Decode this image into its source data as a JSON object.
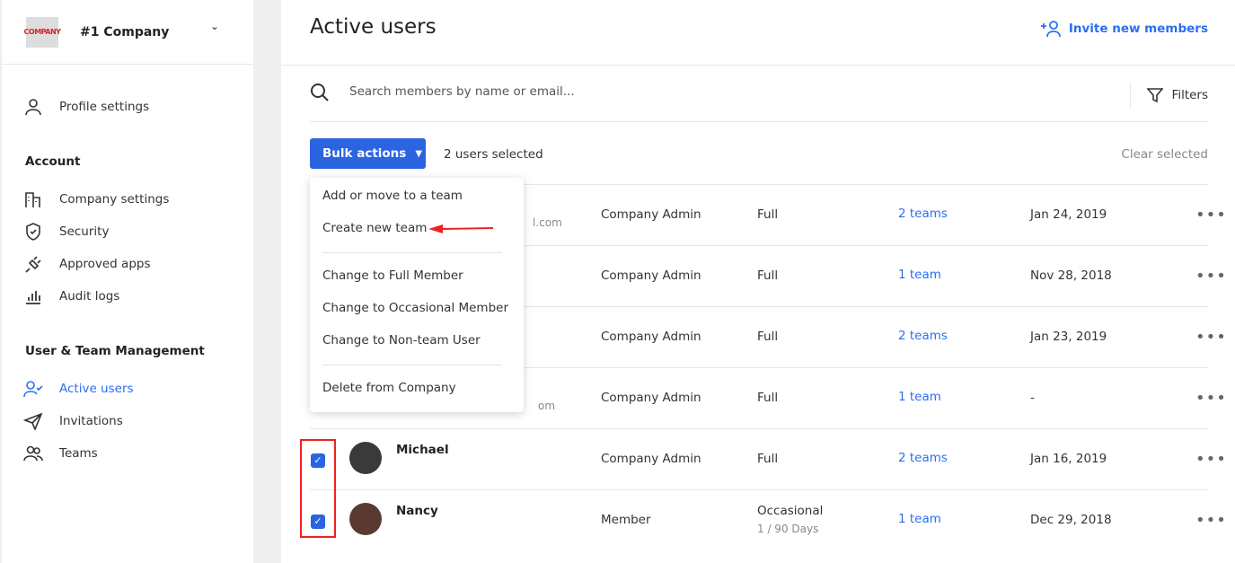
{
  "sidebar": {
    "company": {
      "name": "#1 Company",
      "logo_text": "COMPANY"
    },
    "profile": "Profile settings",
    "account_heading": "Account",
    "account_items": [
      "Company settings",
      "Security",
      "Approved apps",
      "Audit logs"
    ],
    "mgmt_heading": "User & Team Management",
    "mgmt_items": [
      "Active users",
      "Invitations",
      "Teams"
    ],
    "active_item": "Active users",
    "accent": "#2a6ff0"
  },
  "main": {
    "title": "Active users",
    "invite": "Invite new members",
    "search_placeholder": "Search members by name or email...",
    "filters": "Filters",
    "bulk_actions": "Bulk actions",
    "selected": "2 users selected",
    "clear": "Clear selected"
  },
  "menu": {
    "items": [
      "Add or move to a team",
      "Create new team",
      "Change to Full Member",
      "Change to Occasional Member",
      "Change to Non-team User",
      "Delete from Company"
    ]
  },
  "rows": [
    {
      "name": "",
      "email": "l.com",
      "role": "Company Admin",
      "access": "Full",
      "access_sub": "",
      "teams": "2 teams",
      "date": "Jan 24, 2019",
      "checked": false
    },
    {
      "name": "",
      "email": "",
      "role": "Company Admin",
      "access": "Full",
      "access_sub": "",
      "teams": "1 team",
      "date": "Nov 28, 2018",
      "checked": false
    },
    {
      "name": "",
      "email": "",
      "role": "Company Admin",
      "access": "Full",
      "access_sub": "",
      "teams": "2 teams",
      "date": "Jan 23, 2019",
      "checked": false
    },
    {
      "name": "",
      "email": "om",
      "role": "Company Admin",
      "access": "Full",
      "access_sub": "",
      "teams": "1 team",
      "date": "-",
      "checked": false
    },
    {
      "name": "Michael",
      "email": "",
      "role": "Company Admin",
      "access": "Full",
      "access_sub": "",
      "teams": "2 teams",
      "date": "Jan 16, 2019",
      "checked": true
    },
    {
      "name": "Nancy",
      "email": "",
      "role": "Member",
      "access": "Occasional",
      "access_sub": "1 / 90 Days",
      "teams": "1 team",
      "date": "Dec 29, 2018",
      "checked": true
    }
  ]
}
